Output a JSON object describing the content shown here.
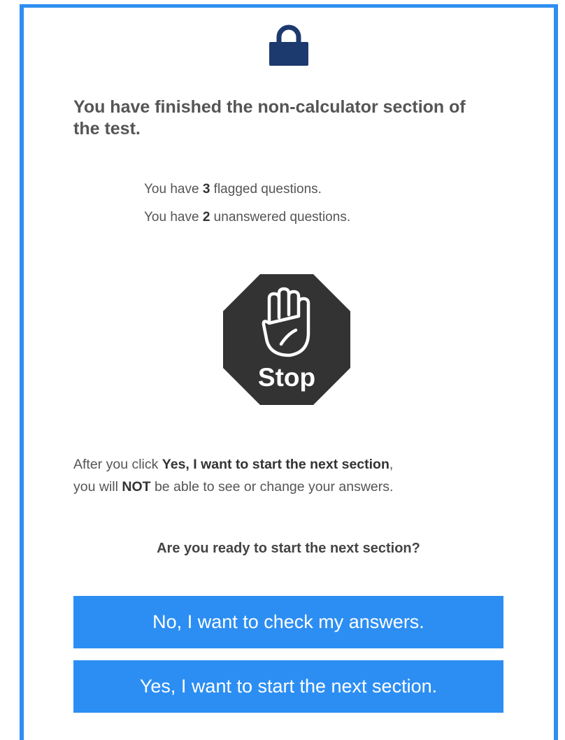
{
  "dialog": {
    "heading": "You have finished the non-calculator section of the test.",
    "flagged": {
      "prefix": "You have ",
      "count": "3",
      "suffix": " flagged questions."
    },
    "unanswered": {
      "prefix": "You have ",
      "count": "2",
      "suffix": " unanswered questions."
    },
    "stop_sign": {
      "label": "Stop",
      "icon": "stop-hand-icon"
    },
    "lock_icon": "lock-icon",
    "warning": {
      "part1": "After you click ",
      "button_ref": "Yes, I want to start the next section",
      "part2": ",",
      "part3": "you will ",
      "emphasis": "NOT",
      "part4": " be able to see or change your answers."
    },
    "question": "Are you ready to start the next section?",
    "buttons": {
      "no": "No, I want to check my answers.",
      "yes": "Yes, I want to start the next section."
    }
  },
  "colors": {
    "accent": "#2e8ef0",
    "button": "#2c8ef3",
    "lock": "#1d3a6e",
    "stop": "#333333"
  }
}
